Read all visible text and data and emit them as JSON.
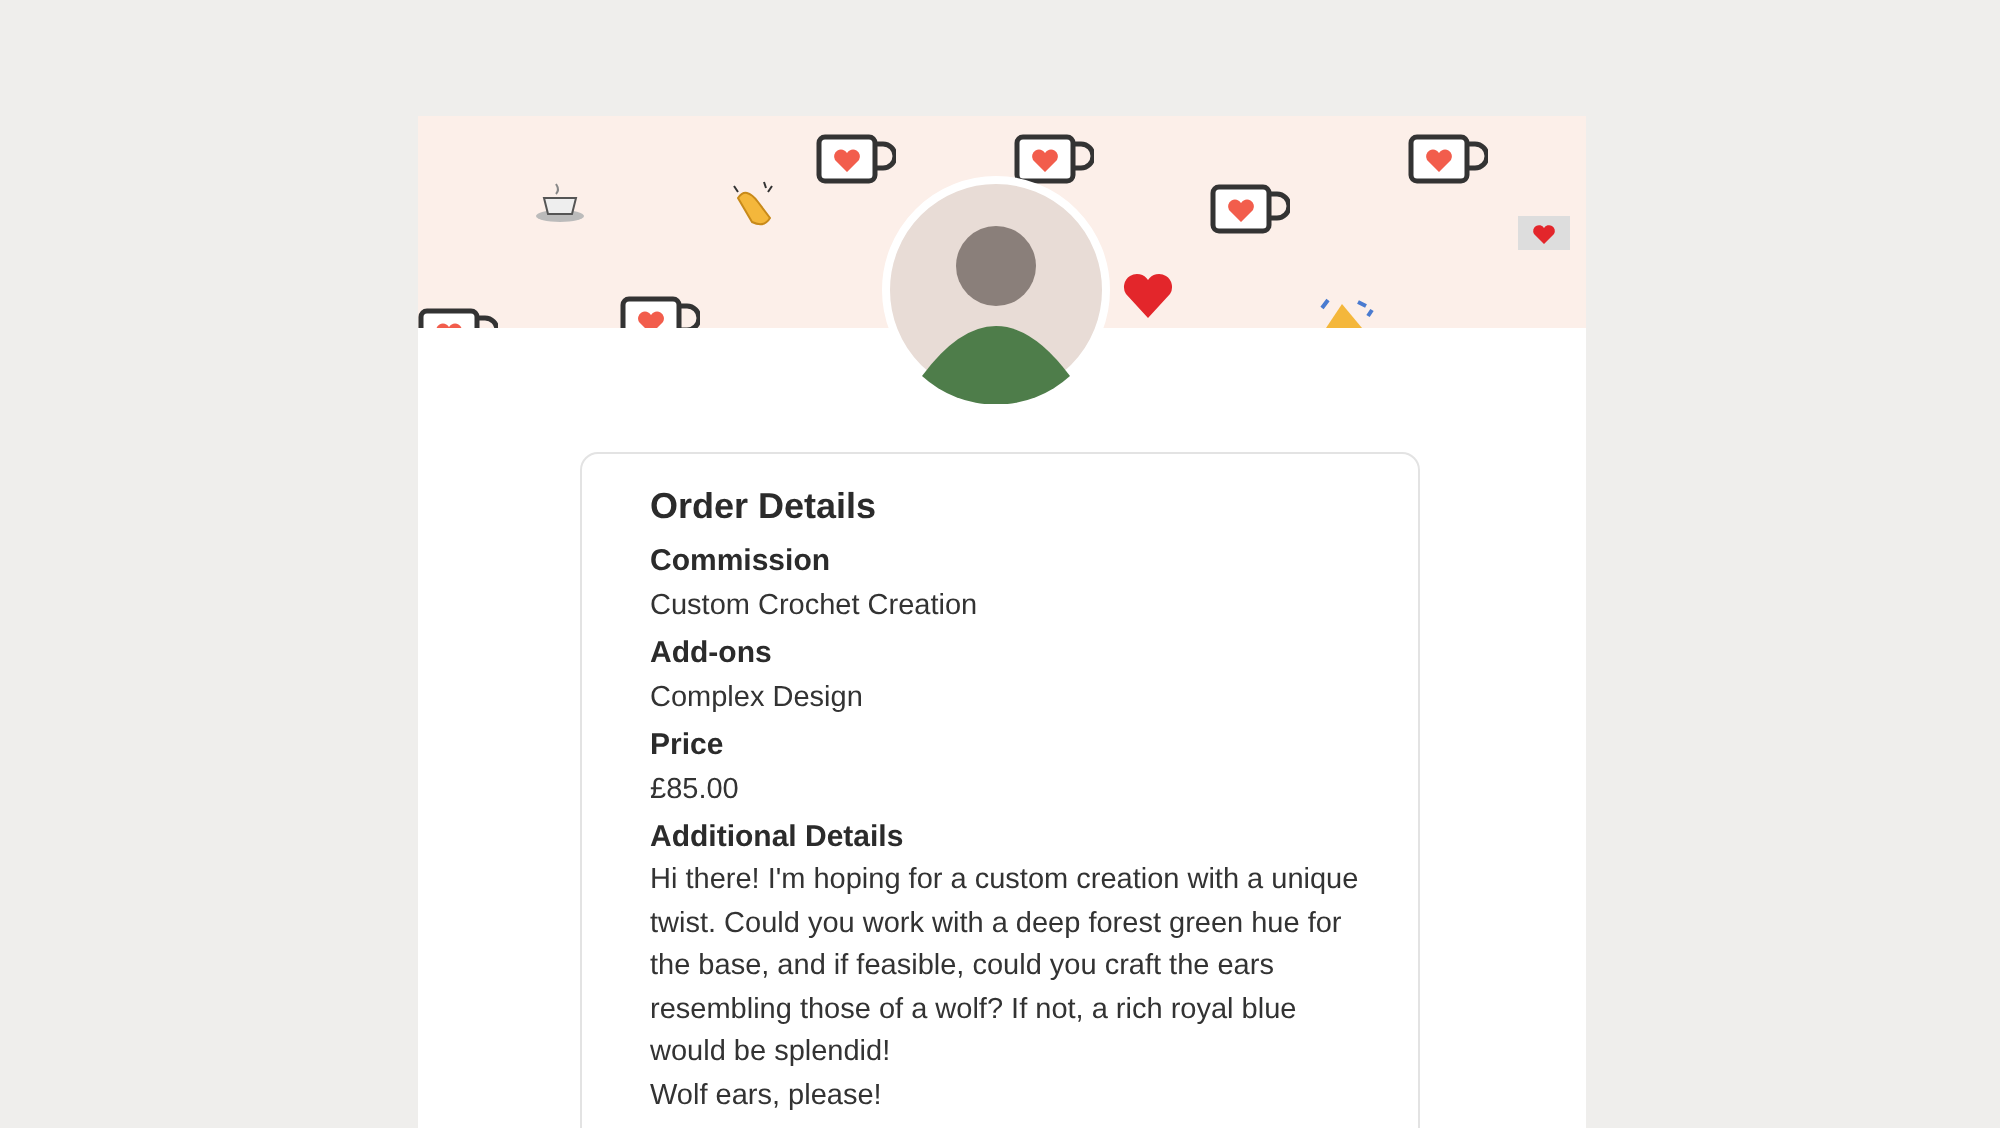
{
  "order": {
    "title": "Order Details",
    "fields": [
      {
        "label": "Commission",
        "value": "Custom Crochet Creation"
      },
      {
        "label": "Add-ons",
        "value": "Complex Design"
      },
      {
        "label": "Price",
        "value": "£85.00"
      }
    ],
    "details_label": "Additional Details",
    "details": [
      "Hi there! I'm hoping for a custom creation with a unique twist. Could you work with a deep forest green hue for the base, and if feasible, could you craft the ears resembling those of a wolf? If not, a rich royal blue would be splendid!",
      "Wolf ears, please!"
    ]
  }
}
